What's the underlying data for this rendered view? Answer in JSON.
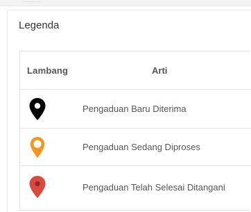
{
  "top_strip": {
    "faint_text": "..........."
  },
  "legend": {
    "title": "Legenda",
    "headers": {
      "symbol": "Lambang",
      "meaning": "Arti"
    },
    "items": [
      {
        "label": "Pengaduan Baru Diterima",
        "icon": "map-pin-black-icon",
        "color": "#000000"
      },
      {
        "label": "Pengaduan Sedang Diproses",
        "icon": "map-pin-orange-icon",
        "color": "#f7941d"
      },
      {
        "label": "Pengaduan Telah Selesai Ditangani",
        "icon": "map-pin-red-icon",
        "color": "#d9493f"
      }
    ]
  }
}
